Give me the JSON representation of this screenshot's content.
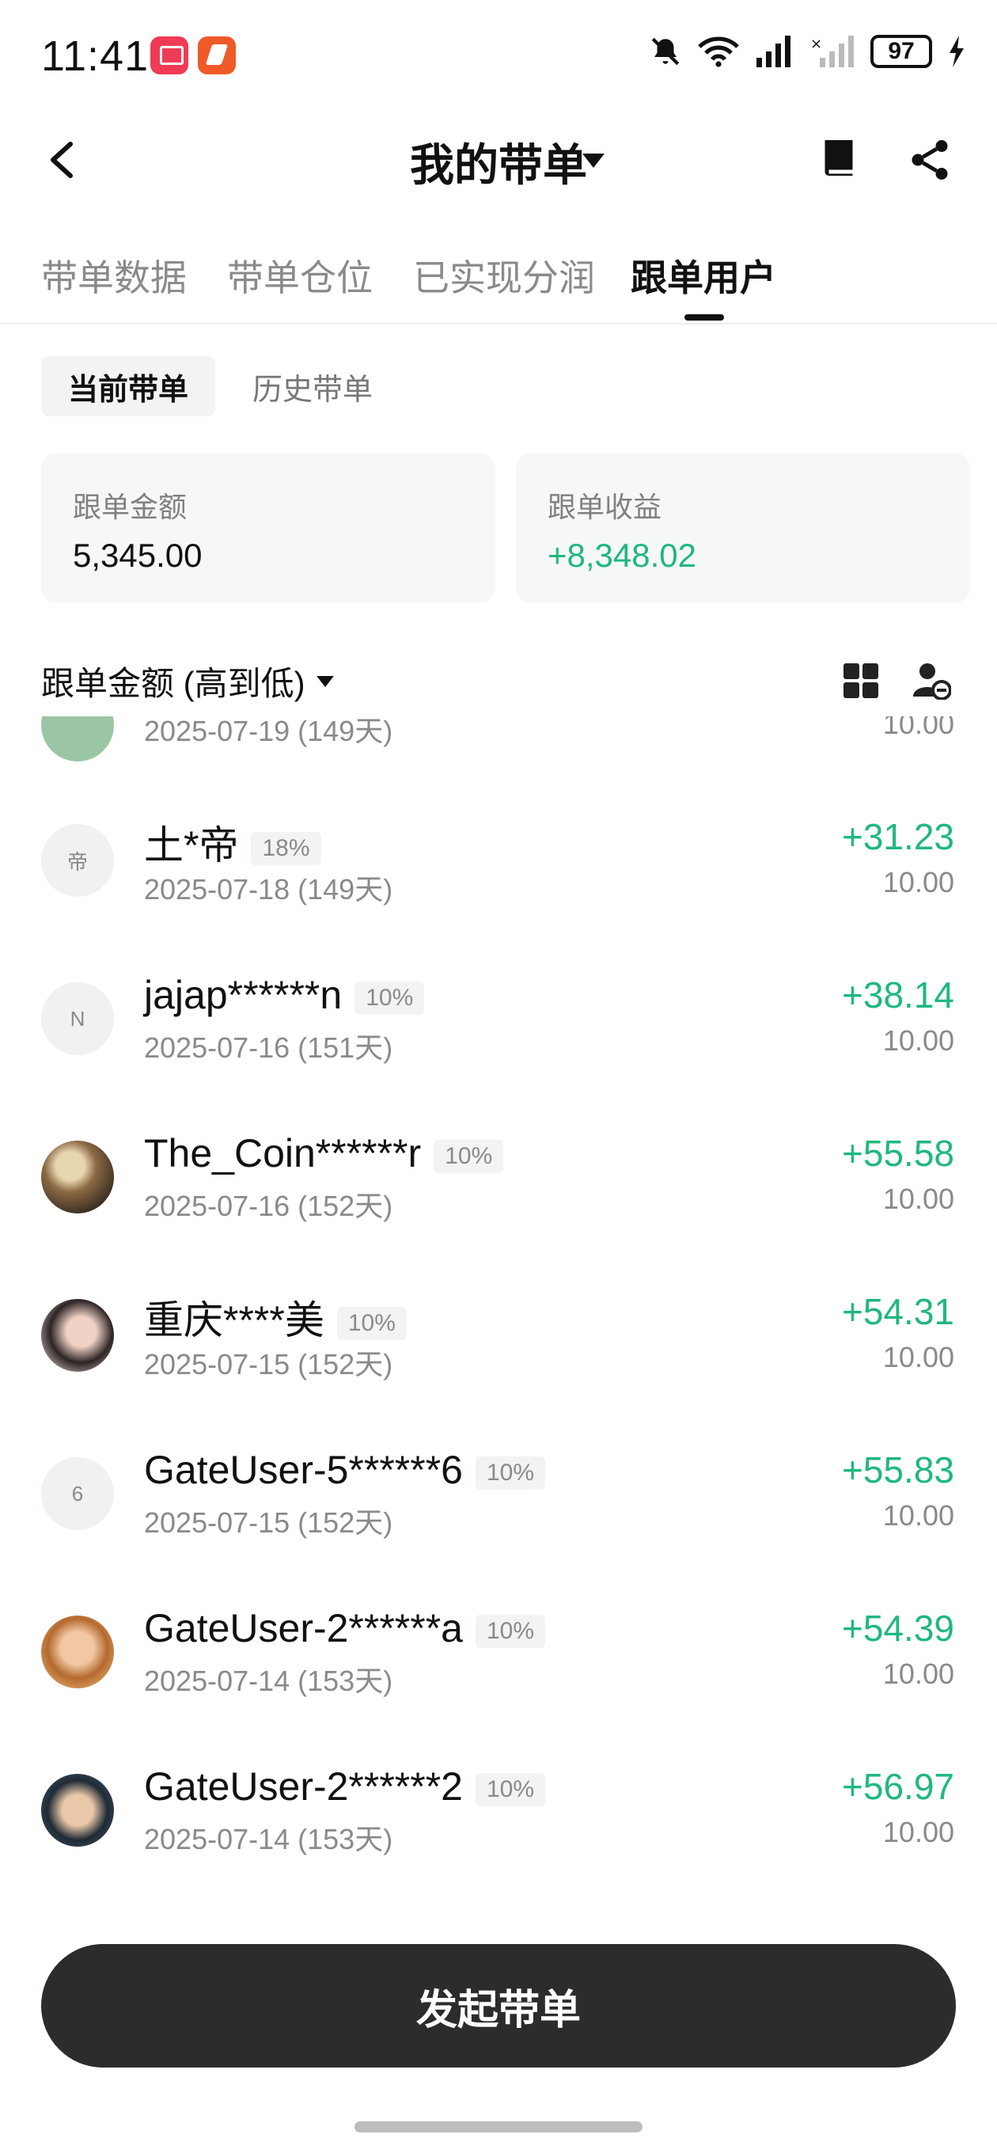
{
  "status_bar": {
    "time": "11:41",
    "battery": "97"
  },
  "header": {
    "title": "我的带单"
  },
  "tabs": [
    {
      "label": "带单数据"
    },
    {
      "label": "带单仓位"
    },
    {
      "label": "已实现分润"
    },
    {
      "label": "跟单用户"
    }
  ],
  "subtabs": {
    "current": "当前带单",
    "history": "历史带单"
  },
  "summary": {
    "amount_label": "跟单金额",
    "amount_value": "5,345.00",
    "profit_label": "跟单收益",
    "profit_value": "+8,348.02"
  },
  "sort": {
    "label": "跟单金额 (高到低)"
  },
  "followers": [
    {
      "avatar_text": "",
      "name": "",
      "pct": "",
      "date": "2025-07-19 (149天)",
      "profit": "",
      "amount": "10.00"
    },
    {
      "avatar_text": "帝",
      "name": "土*帝",
      "pct": "18%",
      "date": "2025-07-18 (149天)",
      "profit": "+31.23",
      "amount": "10.00"
    },
    {
      "avatar_text": "N",
      "name": "jajap******n",
      "pct": "10%",
      "date": "2025-07-16 (151天)",
      "profit": "+38.14",
      "amount": "10.00"
    },
    {
      "avatar_text": "",
      "name": "The_Coin******r",
      "pct": "10%",
      "date": "2025-07-16 (152天)",
      "profit": "+55.58",
      "amount": "10.00"
    },
    {
      "avatar_text": "",
      "name": "重庆****美",
      "pct": "10%",
      "date": "2025-07-15 (152天)",
      "profit": "+54.31",
      "amount": "10.00"
    },
    {
      "avatar_text": "6",
      "name": "GateUser-5******6",
      "pct": "10%",
      "date": "2025-07-15 (152天)",
      "profit": "+55.83",
      "amount": "10.00"
    },
    {
      "avatar_text": "",
      "name": "GateUser-2******a",
      "pct": "10%",
      "date": "2025-07-14 (153天)",
      "profit": "+54.39",
      "amount": "10.00"
    },
    {
      "avatar_text": "",
      "name": "GateUser-2******2",
      "pct": "10%",
      "date": "2025-07-14 (153天)",
      "profit": "+56.97",
      "amount": "10.00"
    }
  ],
  "cta": {
    "label": "发起带单"
  },
  "colors": {
    "positive": "#1fb87e",
    "cta_bg": "#2b2c2e",
    "muted": "#8a8a8a"
  }
}
